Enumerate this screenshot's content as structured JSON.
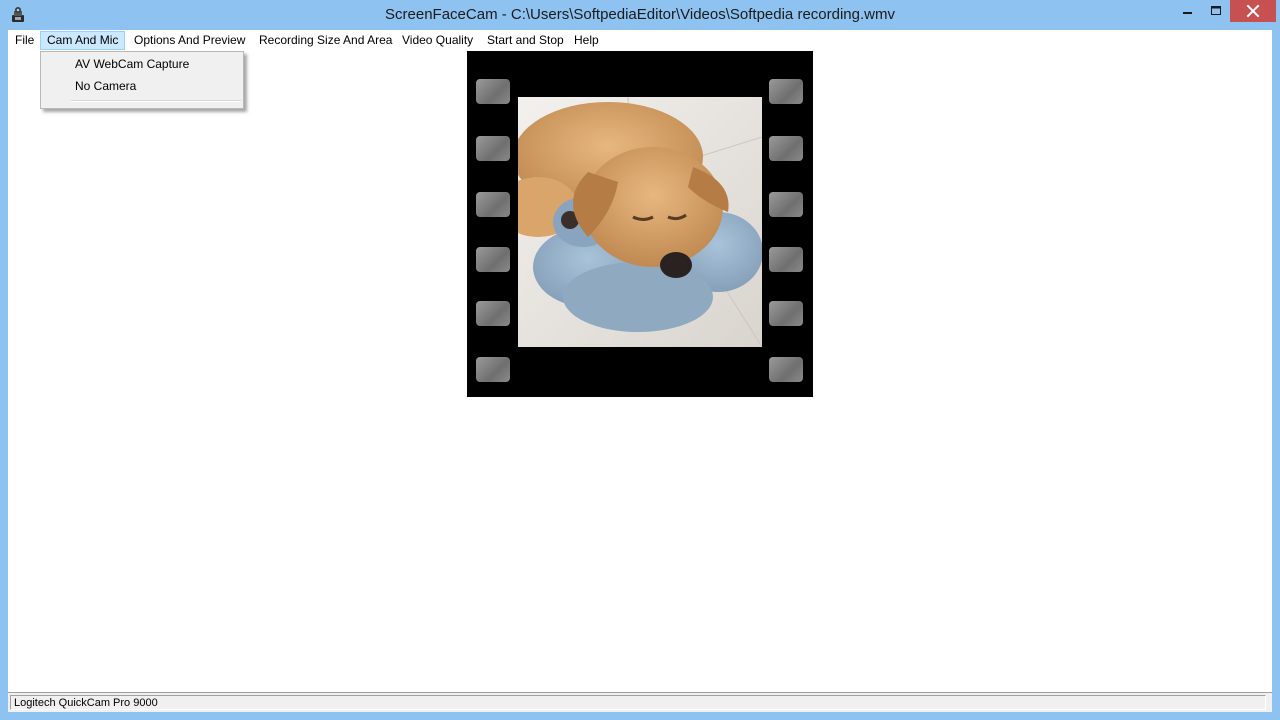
{
  "window": {
    "title": "ScreenFaceCam - C:\\Users\\SoftpediaEditor\\Videos\\Softpedia recording.wmv",
    "accent_color": "#8ec2f0",
    "close_color": "#c75050"
  },
  "menubar": {
    "items": [
      {
        "label": "File"
      },
      {
        "label": "Cam And Mic"
      },
      {
        "label": "Options And Preview"
      },
      {
        "label": "Recording Size And Area"
      },
      {
        "label": "Video Quality"
      },
      {
        "label": "Start and Stop"
      },
      {
        "label": "Help"
      }
    ],
    "active_item": "Cam And Mic"
  },
  "dropdown": {
    "items": [
      {
        "label": "AV WebCam Capture"
      },
      {
        "label": "No Camera"
      }
    ]
  },
  "preview": {
    "frame": "film-strip",
    "content": "webcam-image"
  },
  "statusbar": {
    "text": "Logitech QuickCam Pro 9000"
  },
  "icons": {
    "app": "webcam-icon",
    "minimize": "minimize-icon",
    "maximize": "maximize-icon",
    "close": "close-icon"
  }
}
